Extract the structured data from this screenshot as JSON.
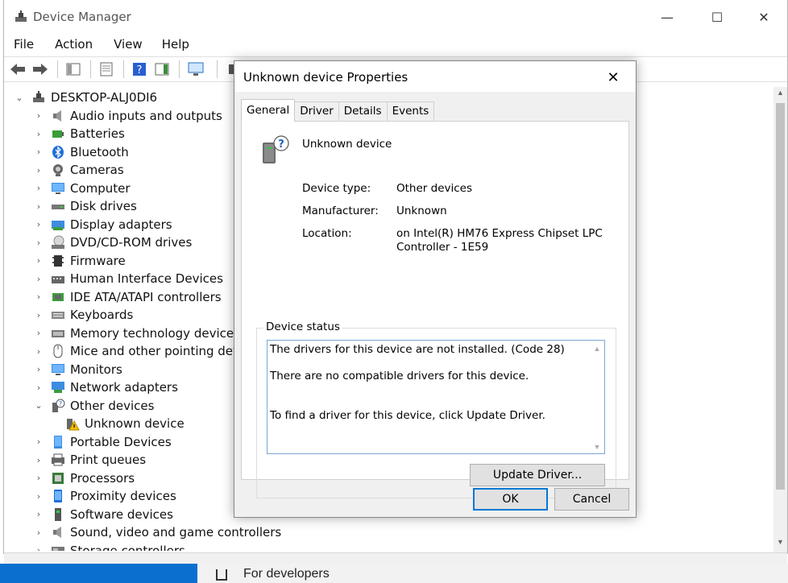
{
  "window": {
    "title": "Device Manager",
    "minimize": "—",
    "maximize": "☐",
    "close": "✕"
  },
  "menu": [
    "File",
    "Action",
    "View",
    "Help"
  ],
  "tree": {
    "root": "DESKTOP-ALJ0DI6",
    "items": [
      {
        "label": "Audio inputs and outputs",
        "icon": "speaker-icon",
        "expanded": false
      },
      {
        "label": "Batteries",
        "icon": "battery-icon",
        "expanded": false
      },
      {
        "label": "Bluetooth",
        "icon": "bluetooth-icon",
        "expanded": false
      },
      {
        "label": "Cameras",
        "icon": "camera-icon",
        "expanded": false
      },
      {
        "label": "Computer",
        "icon": "monitor-icon",
        "expanded": false
      },
      {
        "label": "Disk drives",
        "icon": "disk-icon",
        "expanded": false
      },
      {
        "label": "Display adapters",
        "icon": "display-adapter-icon",
        "expanded": false
      },
      {
        "label": "DVD/CD-ROM drives",
        "icon": "dvd-icon",
        "expanded": false
      },
      {
        "label": "Firmware",
        "icon": "firmware-icon",
        "expanded": false
      },
      {
        "label": "Human Interface Devices",
        "icon": "hid-icon",
        "expanded": false
      },
      {
        "label": "IDE ATA/ATAPI controllers",
        "icon": "ide-icon",
        "expanded": false
      },
      {
        "label": "Keyboards",
        "icon": "keyboard-icon",
        "expanded": false
      },
      {
        "label": "Memory technology devices",
        "icon": "memory-icon",
        "expanded": false
      },
      {
        "label": "Mice and other pointing devices",
        "icon": "mouse-icon",
        "expanded": false
      },
      {
        "label": "Monitors",
        "icon": "monitor-icon",
        "expanded": false
      },
      {
        "label": "Network adapters",
        "icon": "network-icon",
        "expanded": false
      },
      {
        "label": "Other devices",
        "icon": "unknown-device-icon",
        "expanded": true
      },
      {
        "label": "Unknown device",
        "icon": "warning-device-icon",
        "child": true
      },
      {
        "label": "Portable Devices",
        "icon": "portable-icon",
        "expanded": false
      },
      {
        "label": "Print queues",
        "icon": "printer-icon",
        "expanded": false
      },
      {
        "label": "Processors",
        "icon": "processor-icon",
        "expanded": false
      },
      {
        "label": "Proximity devices",
        "icon": "proximity-icon",
        "expanded": false
      },
      {
        "label": "Software devices",
        "icon": "software-icon",
        "expanded": false
      },
      {
        "label": "Sound, video and game controllers",
        "icon": "sound-icon",
        "expanded": false
      },
      {
        "label": "Storage controllers",
        "icon": "storage-icon",
        "expanded": false
      }
    ]
  },
  "background": {
    "partial_text": "For developers"
  },
  "dialog": {
    "title": "Unknown device Properties",
    "close": "✕",
    "tabs": [
      "General",
      "Driver",
      "Details",
      "Events"
    ],
    "active_tab": "General",
    "device_name": "Unknown device",
    "properties": {
      "device_type_label": "Device type:",
      "device_type_value": "Other devices",
      "manufacturer_label": "Manufacturer:",
      "manufacturer_value": "Unknown",
      "location_label": "Location:",
      "location_value": "on Intel(R) HM76 Express Chipset LPC Controller - 1E59"
    },
    "status_group_label": "Device status",
    "status_lines": [
      "The drivers for this device are not installed. (Code 28)",
      "There are no compatible drivers for this device.",
      "To find a driver for this device, click Update Driver."
    ],
    "update_driver_label": "Update Driver...",
    "ok_label": "OK",
    "cancel_label": "Cancel"
  },
  "colors": {
    "accent": "#0078d7",
    "dialog_bg": "#f0f0f0",
    "status_box_border": "#7aa6d6"
  }
}
